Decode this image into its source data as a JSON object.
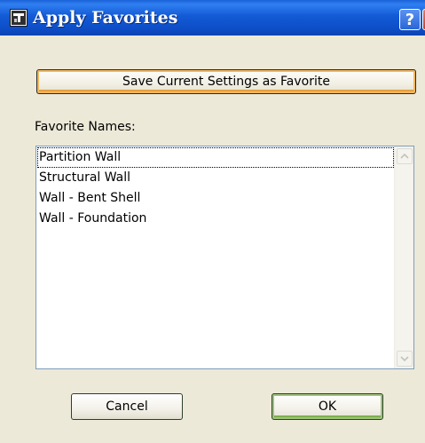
{
  "window": {
    "title": "Apply Favorites",
    "help_symbol": "?",
    "close_symbol": "✕"
  },
  "toolbar": {
    "save_label": "Save Current Settings as Favorite"
  },
  "favorites": {
    "label": "Favorite Names:",
    "items": [
      "Partition Wall",
      "Structural Wall",
      "Wall - Bent Shell",
      "Wall - Foundation"
    ],
    "focused_item": "Partition Wall"
  },
  "footer": {
    "cancel_label": "Cancel",
    "ok_label": "OK"
  },
  "colors": {
    "titlebar": "#0d4ec8",
    "dialog_background": "#ece9d8",
    "save_button_highlight": "#f1b760",
    "ok_button_highlight": "#9fc27a",
    "list_border": "#7f9db9"
  },
  "icons": {
    "app": "favorites-wall-icon",
    "help": "help-icon",
    "close": "close-icon",
    "scroll_up": "scroll-up-arrow-icon",
    "scroll_down": "scroll-down-arrow-icon"
  }
}
